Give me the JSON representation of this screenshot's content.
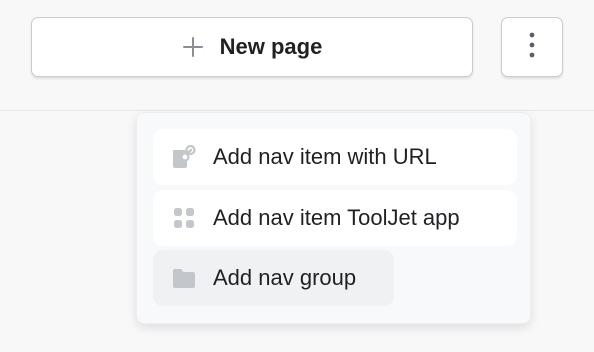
{
  "toolbar": {
    "new_page_label": "New page",
    "plus_icon": "plus-icon",
    "more_icon": "vertical-ellipsis-icon"
  },
  "menu": {
    "items": [
      {
        "label": "Add nav item with URL",
        "icon": "link-icon"
      },
      {
        "label": "Add nav item ToolJet app",
        "icon": "apps-grid-icon"
      },
      {
        "label": "Add nav group",
        "icon": "folder-icon",
        "highlighted": true
      }
    ]
  },
  "colors": {
    "background": "#f8f8f9",
    "button_border": "#c9ccd1",
    "icon_gray": "#c3c6cb",
    "hover_bg": "#eff1f3",
    "text": "#1f2124"
  }
}
